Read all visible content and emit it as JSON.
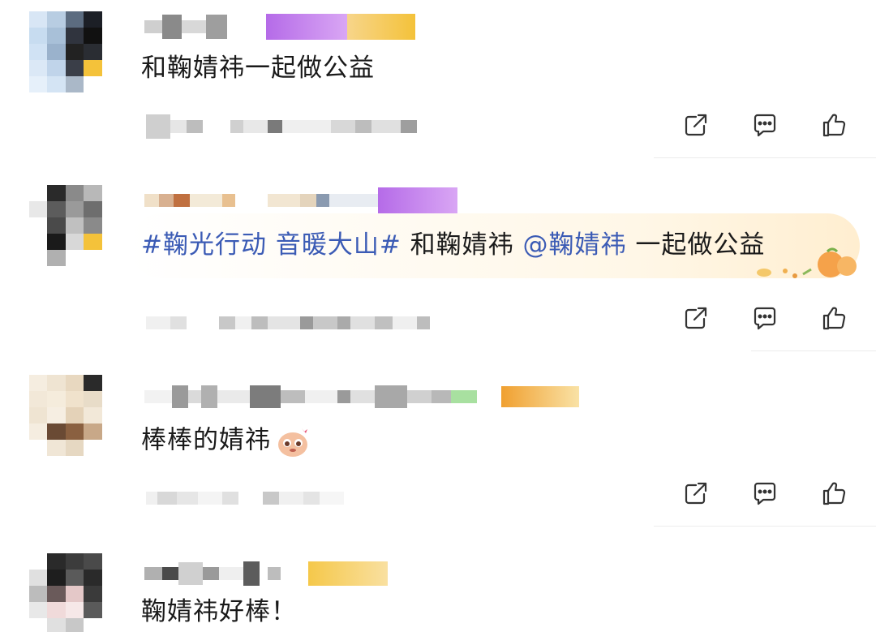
{
  "comments": [
    {
      "text": "和鞠婧祎一起做公益"
    },
    {
      "topic": "#鞠光行动 音暖大山#",
      "text_mid": " 和鞠婧祎 ",
      "mention": "@鞠婧祎",
      "text_end": " 一起做公益"
    },
    {
      "text": "棒棒的婧祎"
    },
    {
      "text": "鞠婧祎好棒！"
    }
  ],
  "actions": {
    "share_icon": "share-icon",
    "comment_icon": "comment-icon",
    "like_icon": "like-icon"
  },
  "colors": {
    "topic": "#3b5bb5",
    "icon": "#333333",
    "divider": "#ececec",
    "badge_purple": "#b56be8",
    "badge_yellow": "#f4c23a"
  }
}
